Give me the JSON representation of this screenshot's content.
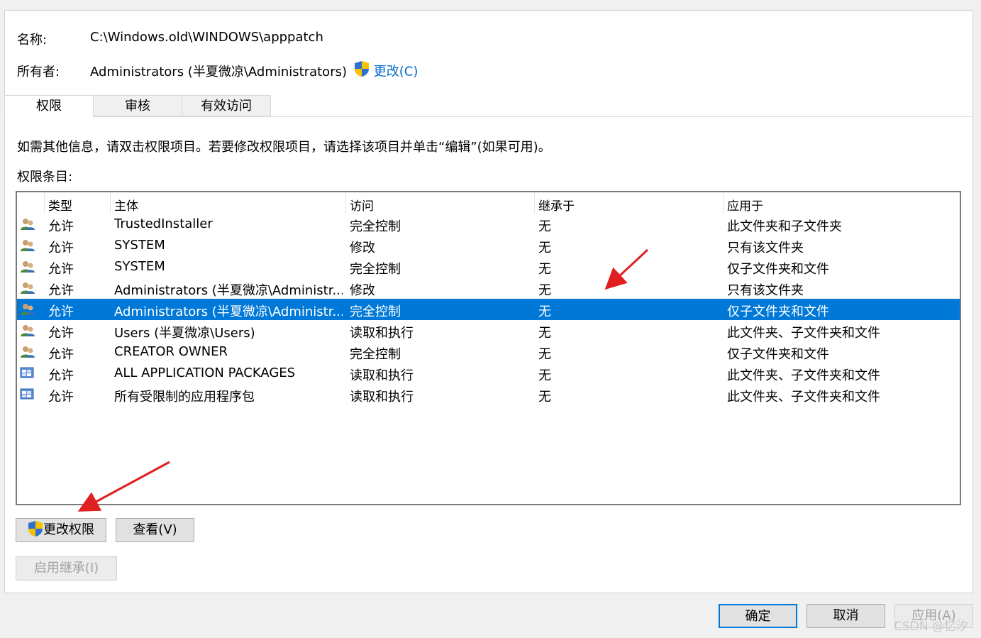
{
  "header": {
    "name_label": "名称:",
    "name_value": "C:\\Windows.old\\WINDOWS\\apppatch",
    "owner_label": "所有者:",
    "owner_value": "Administrators (半夏微凉\\Administrators)",
    "change_owner_link": "更改(C)"
  },
  "tabs": [
    {
      "label": "权限",
      "active": true
    },
    {
      "label": "审核",
      "active": false
    },
    {
      "label": "有效访问",
      "active": false
    }
  ],
  "info_text": "如需其他信息，请双击权限项目。若要修改权限项目，请选择该项目并单击“编辑”(如果可用)。",
  "entries_label": "权限条目:",
  "table": {
    "columns": [
      "类型",
      "主体",
      "访问",
      "继承于",
      "应用于"
    ],
    "rows": [
      {
        "icon": "user-group-icon",
        "type": "允许",
        "principal": "TrustedInstaller",
        "access": "完全控制",
        "inherited": "无",
        "applies": "此文件夹和子文件夹"
      },
      {
        "icon": "user-group-icon",
        "type": "允许",
        "principal": "SYSTEM",
        "access": "修改",
        "inherited": "无",
        "applies": "只有该文件夹"
      },
      {
        "icon": "user-group-icon",
        "type": "允许",
        "principal": "SYSTEM",
        "access": "完全控制",
        "inherited": "无",
        "applies": "仅子文件夹和文件"
      },
      {
        "icon": "user-group-icon",
        "type": "允许",
        "principal": "Administrators (半夏微凉\\Administr...",
        "access": "修改",
        "inherited": "无",
        "applies": "只有该文件夹"
      },
      {
        "icon": "user-group-icon",
        "type": "允许",
        "principal": "Administrators (半夏微凉\\Administr...",
        "access": "完全控制",
        "inherited": "无",
        "applies": "仅子文件夹和文件",
        "selected": true
      },
      {
        "icon": "user-group-icon",
        "type": "允许",
        "principal": "Users (半夏微凉\\Users)",
        "access": "读取和执行",
        "inherited": "无",
        "applies": "此文件夹、子文件夹和文件"
      },
      {
        "icon": "user-group-icon",
        "type": "允许",
        "principal": "CREATOR OWNER",
        "access": "完全控制",
        "inherited": "无",
        "applies": "仅子文件夹和文件"
      },
      {
        "icon": "app-package-icon",
        "type": "允许",
        "principal": "ALL APPLICATION PACKAGES",
        "access": "读取和执行",
        "inherited": "无",
        "applies": "此文件夹、子文件夹和文件"
      },
      {
        "icon": "app-package-icon",
        "type": "允许",
        "principal": "所有受限制的应用程序包",
        "access": "读取和执行",
        "inherited": "无",
        "applies": "此文件夹、子文件夹和文件"
      }
    ]
  },
  "buttons": {
    "change_permissions": "更改权限",
    "view": "查看(V)",
    "enable_inheritance": "启用继承(I)",
    "ok": "确定",
    "cancel": "取消",
    "apply": "应用(A)"
  },
  "watermark": "CSDN @忆汐",
  "colors": {
    "selection": "#0078d7",
    "link": "#0066cc",
    "annotation_arrow": "#e02020"
  }
}
